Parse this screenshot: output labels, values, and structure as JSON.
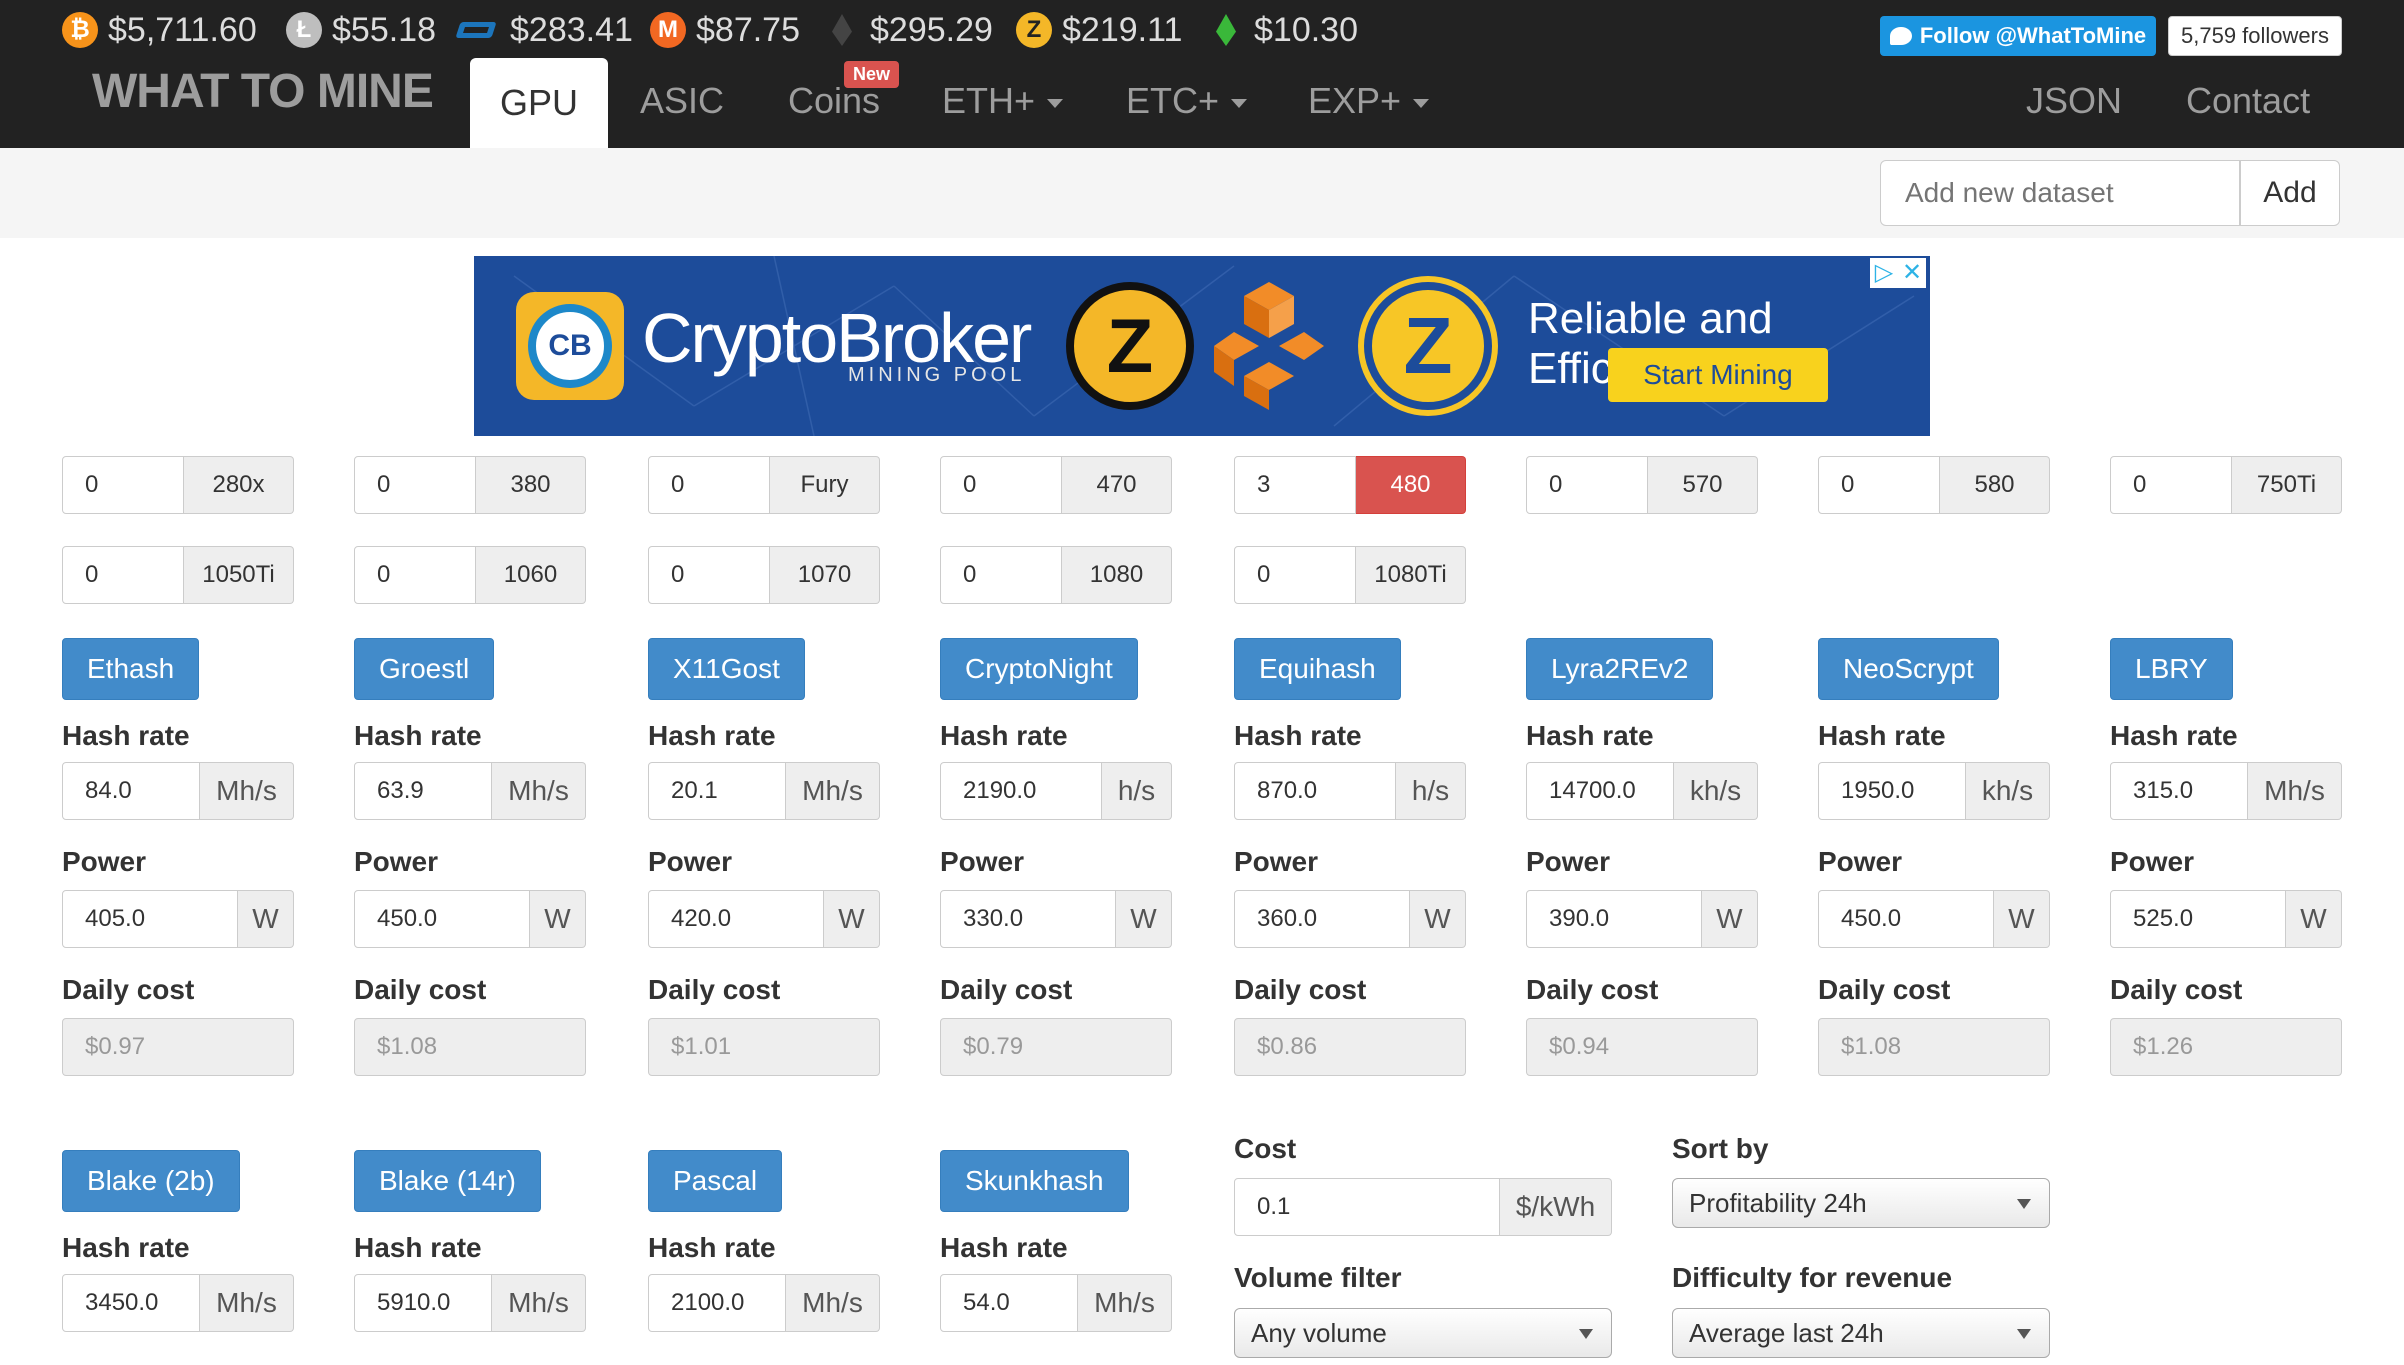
{
  "ticker": [
    {
      "icon": "bitcoin-icon",
      "glyph": "₿",
      "price": "$5,711.60"
    },
    {
      "icon": "litecoin-icon",
      "glyph": "Ł",
      "price": "$55.18"
    },
    {
      "icon": "dash-icon",
      "glyph": "",
      "price": "$283.41"
    },
    {
      "icon": "monero-icon",
      "glyph": "M",
      "price": "$87.75"
    },
    {
      "icon": "ethereum-icon",
      "glyph": "",
      "price": "$295.29"
    },
    {
      "icon": "zcash-icon",
      "glyph": "Z",
      "price": "$219.11"
    },
    {
      "icon": "ethereum-classic-icon",
      "glyph": "",
      "price": "$10.30"
    }
  ],
  "twitter": {
    "follow_label": "Follow @WhatToMine",
    "followers": "5,759 followers"
  },
  "nav": {
    "brand": "WHAT TO MINE",
    "gpu": "GPU",
    "asic": "ASIC",
    "coins": "Coins",
    "new_badge": "New",
    "eth": "ETH+",
    "etc": "ETC+",
    "exp": "EXP+",
    "json": "JSON",
    "contact": "Contact"
  },
  "dataset": {
    "placeholder": "Add new dataset",
    "add_label": "Add"
  },
  "ad": {
    "logo_text": "CB",
    "title": "CryptoBroker",
    "subtitle": "MINING POOL",
    "zec_glyph": "Z",
    "zen_glyph": "Z",
    "slogan": "Reliable and Efficient",
    "cta": "Start Mining",
    "choice_play": "▷",
    "choice_close": "✕"
  },
  "gpus": [
    {
      "count": "0",
      "name": "280x"
    },
    {
      "count": "0",
      "name": "380"
    },
    {
      "count": "0",
      "name": "Fury"
    },
    {
      "count": "0",
      "name": "470"
    },
    {
      "count": "3",
      "name": "480"
    },
    {
      "count": "0",
      "name": "570"
    },
    {
      "count": "0",
      "name": "580"
    },
    {
      "count": "0",
      "name": "750Ti"
    },
    {
      "count": "0",
      "name": "1050Ti"
    },
    {
      "count": "0",
      "name": "1060"
    },
    {
      "count": "0",
      "name": "1070"
    },
    {
      "count": "0",
      "name": "1080"
    },
    {
      "count": "0",
      "name": "1080Ti"
    }
  ],
  "labels": {
    "hash_rate": "Hash rate",
    "power": "Power",
    "daily_cost": "Daily cost",
    "power_unit": "W"
  },
  "algos": [
    {
      "name": "Ethash",
      "hash": "84.0",
      "unit": "Mh/s",
      "power": "405.0",
      "cost": "$0.97"
    },
    {
      "name": "Groestl",
      "hash": "63.9",
      "unit": "Mh/s",
      "power": "450.0",
      "cost": "$1.08"
    },
    {
      "name": "X11Gost",
      "hash": "20.1",
      "unit": "Mh/s",
      "power": "420.0",
      "cost": "$1.01"
    },
    {
      "name": "CryptoNight",
      "hash": "2190.0",
      "unit": "h/s",
      "power": "330.0",
      "cost": "$0.79"
    },
    {
      "name": "Equihash",
      "hash": "870.0",
      "unit": "h/s",
      "power": "360.0",
      "cost": "$0.86"
    },
    {
      "name": "Lyra2REv2",
      "hash": "14700.0",
      "unit": "kh/s",
      "power": "390.0",
      "cost": "$0.94"
    },
    {
      "name": "NeoScrypt",
      "hash": "1950.0",
      "unit": "kh/s",
      "power": "450.0",
      "cost": "$1.08"
    },
    {
      "name": "LBRY",
      "hash": "315.0",
      "unit": "Mh/s",
      "power": "525.0",
      "cost": "$1.26"
    },
    {
      "name": "Blake (2b)",
      "hash": "3450.0",
      "unit": "Mh/s"
    },
    {
      "name": "Blake (14r)",
      "hash": "5910.0",
      "unit": "Mh/s"
    },
    {
      "name": "Pascal",
      "hash": "2100.0",
      "unit": "Mh/s"
    },
    {
      "name": "Skunkhash",
      "hash": "54.0",
      "unit": "Mh/s"
    }
  ],
  "settings": {
    "cost_label": "Cost",
    "cost_value": "0.1",
    "cost_unit": "$/kWh",
    "sort_label": "Sort by",
    "sort_value": "Profitability 24h",
    "volume_label": "Volume filter",
    "volume_value": "Any volume",
    "difficulty_label": "Difficulty for revenue",
    "difficulty_value": "Average last 24h"
  },
  "colors": {
    "topbar": "#222222",
    "primary": "#428bca",
    "danger": "#d9534f",
    "twitter": "#1b95e0",
    "ad_bg": "#1d4c9a",
    "ad_cta": "#f8d21d"
  }
}
